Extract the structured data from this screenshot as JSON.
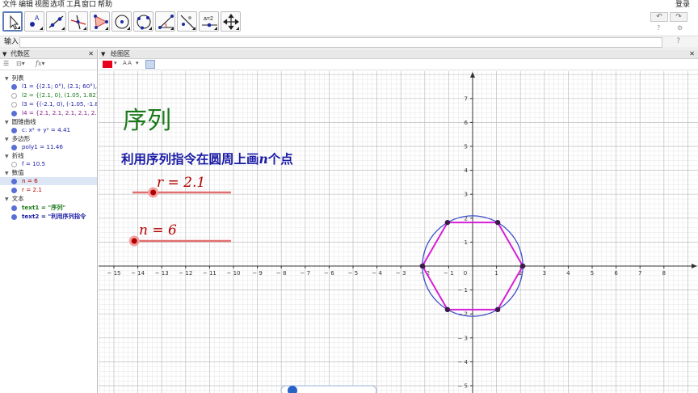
{
  "menu": {
    "items": [
      "文件",
      "编辑",
      "视图",
      "选项",
      "工具",
      "窗口",
      "帮助"
    ],
    "login": "登录"
  },
  "toolbar": {
    "tools": [
      {
        "name": "move-tool-icon"
      },
      {
        "name": "point-tool-icon"
      },
      {
        "name": "line-tool-icon"
      },
      {
        "name": "perpendicular-line-tool-icon"
      },
      {
        "name": "polygon-tool-icon"
      },
      {
        "name": "circle-center-point-tool-icon"
      },
      {
        "name": "circle-three-points-tool-icon"
      },
      {
        "name": "angle-tool-icon"
      },
      {
        "name": "reflect-tool-icon"
      },
      {
        "name": "slider-tool-icon",
        "text": "a=2"
      },
      {
        "name": "move-graphics-tool-icon"
      }
    ],
    "undo": "↶",
    "redo": "↷",
    "help_icon": "?",
    "settings_icon": "⚙"
  },
  "input_bar": {
    "label": "输入:",
    "value": "",
    "help": "?"
  },
  "algebra": {
    "title": "代数区",
    "groups": {
      "list": "列表",
      "conic": "圆锥曲线",
      "polygon": "多边形",
      "polyline": "折线",
      "number": "数值",
      "text": "文本"
    },
    "rows": {
      "l1": "l1 = {(2.1; 0°), (2.1; 60°), (2.1",
      "l2": "l2 = {(2.1, 0), (1.05, 1.82), (-1",
      "l3": "l3 = {(-2.1, 0), (-1.05, -1.82), (",
      "l4": "l4 = {2.1, 2.1, 2.1, 2.1, 2.1, 2.",
      "c": "c: x² + y² = 4.41",
      "poly1": "poly1 = 11.46",
      "f": "f = 10.5",
      "n": "n = 6",
      "r": "r = 2.1",
      "text1": "text1 = \"序列\"",
      "text2": "text2 = \"利用序列指令"
    },
    "colors": {
      "l1": "#1a1aa6",
      "l2": "#1a7a1a",
      "l3": "#1a1aa6",
      "l4": "#8b1a8b",
      "c": "#1a1aa6",
      "poly1": "#1a1aa6",
      "f": "#1a1aa6",
      "n": "#b30000",
      "r": "#b30000",
      "text1": "#1a7a1a",
      "text2": "#1a1aa6"
    }
  },
  "graphics": {
    "title": "绘图区",
    "style_bar": {
      "label_style": "A A"
    },
    "title_text": "序列",
    "subtitle_pre": "利用序列指令在圆周上画",
    "subtitle_var": "n",
    "subtitle_post": "个点",
    "slider_r_label": "r = 2.1",
    "slider_n_label": "n = 6",
    "slider_r_value": 2.1,
    "slider_n_value": 6,
    "circle_radius": 2.1,
    "n_points": 6,
    "x_ticks": [
      -15,
      -14,
      -13,
      -12,
      -11,
      -10,
      -9,
      -8,
      -7,
      -6,
      -5,
      -4,
      -3,
      -2,
      -1,
      0,
      1,
      2,
      3,
      4,
      5,
      6,
      7,
      8
    ],
    "y_ticks": [
      -5,
      -4,
      -3,
      -2,
      -1,
      1,
      2,
      3,
      4,
      5,
      6,
      7
    ],
    "colors": {
      "title": "#1a7a1a",
      "subtitle": "#1a1aa6",
      "circle": "#3c4fc8",
      "polygon": "#d61fd6",
      "point": "#3a1a4a",
      "slider_line": "#e07070",
      "slider_knob": "#b30000",
      "slider_label": "#b30000",
      "axis": "#333333",
      "grid_major": "#c0c0c0",
      "grid_minor": "#e6e6e6"
    }
  }
}
